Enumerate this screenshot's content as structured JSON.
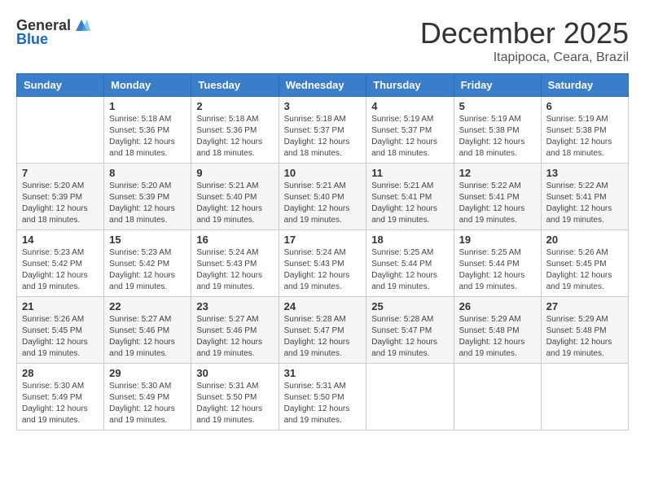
{
  "header": {
    "logo_general": "General",
    "logo_blue": "Blue",
    "month_title": "December 2025",
    "location": "Itapipoca, Ceara, Brazil"
  },
  "calendar": {
    "days_of_week": [
      "Sunday",
      "Monday",
      "Tuesday",
      "Wednesday",
      "Thursday",
      "Friday",
      "Saturday"
    ],
    "weeks": [
      [
        {
          "day": "",
          "info": ""
        },
        {
          "day": "1",
          "info": "Sunrise: 5:18 AM\nSunset: 5:36 PM\nDaylight: 12 hours\nand 18 minutes."
        },
        {
          "day": "2",
          "info": "Sunrise: 5:18 AM\nSunset: 5:36 PM\nDaylight: 12 hours\nand 18 minutes."
        },
        {
          "day": "3",
          "info": "Sunrise: 5:18 AM\nSunset: 5:37 PM\nDaylight: 12 hours\nand 18 minutes."
        },
        {
          "day": "4",
          "info": "Sunrise: 5:19 AM\nSunset: 5:37 PM\nDaylight: 12 hours\nand 18 minutes."
        },
        {
          "day": "5",
          "info": "Sunrise: 5:19 AM\nSunset: 5:38 PM\nDaylight: 12 hours\nand 18 minutes."
        },
        {
          "day": "6",
          "info": "Sunrise: 5:19 AM\nSunset: 5:38 PM\nDaylight: 12 hours\nand 18 minutes."
        }
      ],
      [
        {
          "day": "7",
          "info": "Sunrise: 5:20 AM\nSunset: 5:39 PM\nDaylight: 12 hours\nand 18 minutes."
        },
        {
          "day": "8",
          "info": "Sunrise: 5:20 AM\nSunset: 5:39 PM\nDaylight: 12 hours\nand 18 minutes."
        },
        {
          "day": "9",
          "info": "Sunrise: 5:21 AM\nSunset: 5:40 PM\nDaylight: 12 hours\nand 19 minutes."
        },
        {
          "day": "10",
          "info": "Sunrise: 5:21 AM\nSunset: 5:40 PM\nDaylight: 12 hours\nand 19 minutes."
        },
        {
          "day": "11",
          "info": "Sunrise: 5:21 AM\nSunset: 5:41 PM\nDaylight: 12 hours\nand 19 minutes."
        },
        {
          "day": "12",
          "info": "Sunrise: 5:22 AM\nSunset: 5:41 PM\nDaylight: 12 hours\nand 19 minutes."
        },
        {
          "day": "13",
          "info": "Sunrise: 5:22 AM\nSunset: 5:41 PM\nDaylight: 12 hours\nand 19 minutes."
        }
      ],
      [
        {
          "day": "14",
          "info": "Sunrise: 5:23 AM\nSunset: 5:42 PM\nDaylight: 12 hours\nand 19 minutes."
        },
        {
          "day": "15",
          "info": "Sunrise: 5:23 AM\nSunset: 5:42 PM\nDaylight: 12 hours\nand 19 minutes."
        },
        {
          "day": "16",
          "info": "Sunrise: 5:24 AM\nSunset: 5:43 PM\nDaylight: 12 hours\nand 19 minutes."
        },
        {
          "day": "17",
          "info": "Sunrise: 5:24 AM\nSunset: 5:43 PM\nDaylight: 12 hours\nand 19 minutes."
        },
        {
          "day": "18",
          "info": "Sunrise: 5:25 AM\nSunset: 5:44 PM\nDaylight: 12 hours\nand 19 minutes."
        },
        {
          "day": "19",
          "info": "Sunrise: 5:25 AM\nSunset: 5:44 PM\nDaylight: 12 hours\nand 19 minutes."
        },
        {
          "day": "20",
          "info": "Sunrise: 5:26 AM\nSunset: 5:45 PM\nDaylight: 12 hours\nand 19 minutes."
        }
      ],
      [
        {
          "day": "21",
          "info": "Sunrise: 5:26 AM\nSunset: 5:45 PM\nDaylight: 12 hours\nand 19 minutes."
        },
        {
          "day": "22",
          "info": "Sunrise: 5:27 AM\nSunset: 5:46 PM\nDaylight: 12 hours\nand 19 minutes."
        },
        {
          "day": "23",
          "info": "Sunrise: 5:27 AM\nSunset: 5:46 PM\nDaylight: 12 hours\nand 19 minutes."
        },
        {
          "day": "24",
          "info": "Sunrise: 5:28 AM\nSunset: 5:47 PM\nDaylight: 12 hours\nand 19 minutes."
        },
        {
          "day": "25",
          "info": "Sunrise: 5:28 AM\nSunset: 5:47 PM\nDaylight: 12 hours\nand 19 minutes."
        },
        {
          "day": "26",
          "info": "Sunrise: 5:29 AM\nSunset: 5:48 PM\nDaylight: 12 hours\nand 19 minutes."
        },
        {
          "day": "27",
          "info": "Sunrise: 5:29 AM\nSunset: 5:48 PM\nDaylight: 12 hours\nand 19 minutes."
        }
      ],
      [
        {
          "day": "28",
          "info": "Sunrise: 5:30 AM\nSunset: 5:49 PM\nDaylight: 12 hours\nand 19 minutes."
        },
        {
          "day": "29",
          "info": "Sunrise: 5:30 AM\nSunset: 5:49 PM\nDaylight: 12 hours\nand 19 minutes."
        },
        {
          "day": "30",
          "info": "Sunrise: 5:31 AM\nSunset: 5:50 PM\nDaylight: 12 hours\nand 19 minutes."
        },
        {
          "day": "31",
          "info": "Sunrise: 5:31 AM\nSunset: 5:50 PM\nDaylight: 12 hours\nand 19 minutes."
        },
        {
          "day": "",
          "info": ""
        },
        {
          "day": "",
          "info": ""
        },
        {
          "day": "",
          "info": ""
        }
      ]
    ]
  }
}
